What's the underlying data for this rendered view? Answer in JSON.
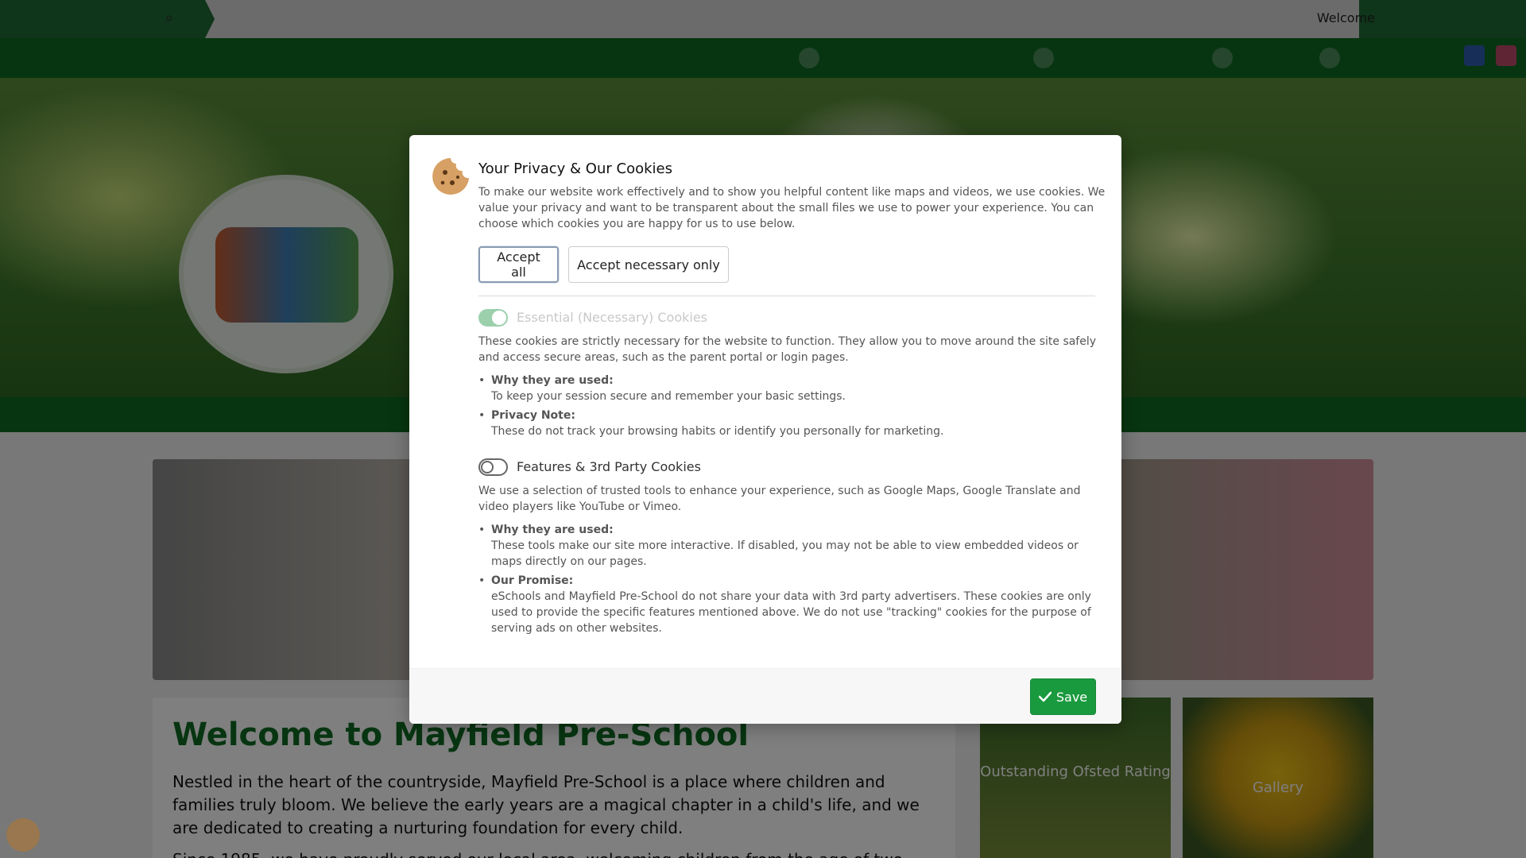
{
  "background": {
    "top_welcome": "Welcome",
    "main_heading": "Welcome to Mayfield Pre-School",
    "main_para_1": "Nestled in the heart of the countryside, Mayfield Pre-School is a place where children and families truly bloom. We believe the early years are a magical chapter in a child's life, and we are dedicated to creating a nurturing foundation for every child.",
    "main_para_2": "Since 1985, we have proudly served our local area, welcoming children from the age of two",
    "tile_1": "Outstanding Ofsted Rating",
    "tile_2": "Gallery"
  },
  "modal": {
    "title": "Your Privacy & Our Cookies",
    "intro": "To make our website work effectively and to show you helpful content like maps and videos, we use cookies. We value your privacy and want to be transparent about the small files we use to power your experience. You can choose which cookies you are happy for us to use below.",
    "accept_all": "Accept all",
    "accept_necessary": "Accept necessary only",
    "essential": {
      "title": "Essential (Necessary) Cookies",
      "enabled": true,
      "description": "These cookies are strictly necessary for the website to function. They allow you to move around the site safely and access secure areas, such as the parent portal or login pages.",
      "bullets": [
        {
          "title": "Why they are used:",
          "text": "To keep your session secure and remember your basic settings."
        },
        {
          "title": "Privacy Note:",
          "text": "These do not track your browsing habits or identify you personally for marketing."
        }
      ]
    },
    "features": {
      "title": "Features & 3rd Party Cookies",
      "enabled": false,
      "description": "We use a selection of trusted tools to enhance your experience, such as Google Maps, Google Translate and video players like YouTube or Vimeo.",
      "bullets": [
        {
          "title": "Why they are used:",
          "text": "These tools make our site more interactive. If disabled, you may not be able to view embedded videos or maps directly on our pages."
        },
        {
          "title": "Our Promise:",
          "text": "eSchools and Mayfield Pre-School do not share your data with 3rd party advertisers. These cookies are only used to provide the specific features mentioned above. We do not use \"tracking\" cookies for the purpose of serving ads on other websites."
        }
      ]
    },
    "save": "Save"
  },
  "colors": {
    "brand_green": "#0e6b22",
    "save_green": "#1a9a3e",
    "toggle_on": "#8bc79e"
  },
  "icons": {
    "cookie": "cookie-icon",
    "check": "check-icon",
    "search": "search-icon"
  }
}
